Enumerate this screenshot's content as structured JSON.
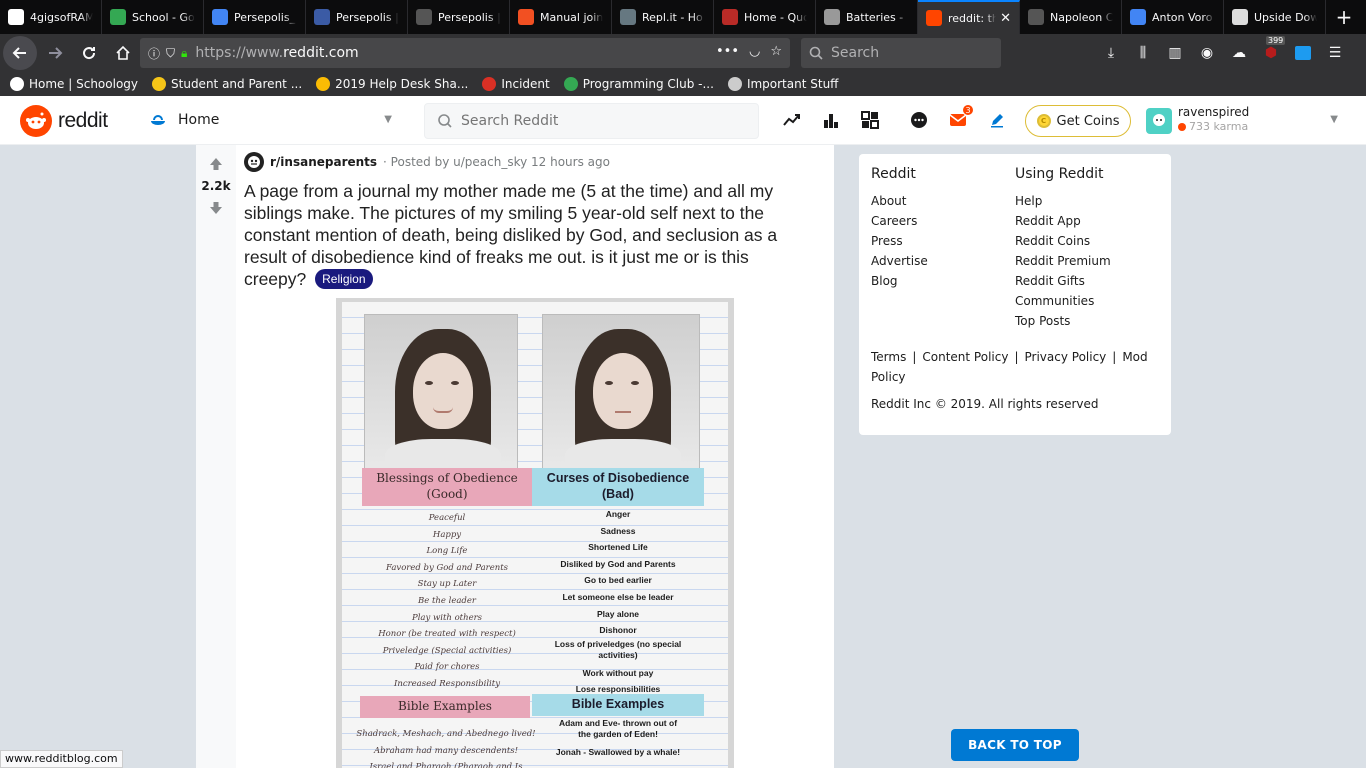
{
  "browser": {
    "tabs": [
      {
        "title": "4gigsofRAM",
        "icon_color": "#ffffff",
        "icon": "firefox-icon"
      },
      {
        "title": "School - Go",
        "icon_color": "#34a853",
        "icon": "google-drive-icon"
      },
      {
        "title": "Persepolis_",
        "icon_color": "#4285f4",
        "icon": "google-docs-icon"
      },
      {
        "title": "Persepolis |",
        "icon_color": "#3b5ba5",
        "icon": "quizlet-icon"
      },
      {
        "title": "Persepolis |",
        "icon_color": "#555555",
        "icon": "schoology-icon"
      },
      {
        "title": "Manual join",
        "icon_color": "#f25022",
        "icon": "microsoft-icon"
      },
      {
        "title": "Repl.it - Ho",
        "icon_color": "#667881",
        "icon": "replit-icon"
      },
      {
        "title": "Home - Quo",
        "icon_color": "#b92b27",
        "icon": "quora-icon"
      },
      {
        "title": "Batteries -",
        "icon_color": "#999999",
        "icon": "apple-icon"
      },
      {
        "title": "reddit: the",
        "icon_color": "#ff4500",
        "icon": "reddit-icon",
        "active": true
      },
      {
        "title": "Napoleon C",
        "icon_color": "#555555",
        "icon": "schoology-icon"
      },
      {
        "title": "Anton Voro",
        "icon_color": "#4285f4",
        "icon": "google-docs-icon"
      },
      {
        "title": "Upside Dow",
        "icon_color": "#dddddd",
        "icon": "page-icon"
      }
    ],
    "url_prefix": "https://www.",
    "url_domain": "reddit.com",
    "search_placeholder": "Search",
    "addon_badge": "399",
    "bookmarks": [
      {
        "label": "Home | Schoology",
        "icon_color": "#ffffff",
        "icon": "schoology-icon"
      },
      {
        "label": "Student and Parent ...",
        "icon_color": "#f5c518",
        "icon": "p-icon"
      },
      {
        "label": "2019 Help Desk Sha...",
        "icon_color": "#fbbc04",
        "icon": "google-drive-icon"
      },
      {
        "label": "Incident",
        "icon_color": "#d93025",
        "icon": "incident-icon"
      },
      {
        "label": "Programming Club -...",
        "icon_color": "#34a853",
        "icon": "google-drive-icon"
      },
      {
        "label": "Important Stuff",
        "icon_color": "#cccccc",
        "icon": "folder-icon"
      }
    ]
  },
  "reddit": {
    "logo_text": "reddit",
    "home_label": "Home",
    "search_placeholder": "Search Reddit",
    "mail_badge": "3",
    "get_coins_label": "Get Coins",
    "username": "ravenspired",
    "karma": "733 karma"
  },
  "post": {
    "votes": "2.2k",
    "subreddit": "r/insaneparents",
    "posted_by": "· Posted by u/peach_sky 12 hours ago",
    "title": "A page from a journal my mother made me (5 at the time) and all my siblings make. The pictures of my smiling 5 year-old self next to the constant mention of death, being disliked by God, and seclusion as a result of disobedience kind of freaks me out. is it just me or is this creepy?",
    "flair": "Religion",
    "journal": {
      "left_heading": "Blessings of Obedience (Good)",
      "right_heading": "Curses of Disobedience (Bad)",
      "left_items": [
        "Peaceful",
        "Happy",
        "Long Life",
        "Favored by God and Parents",
        "Stay up Later",
        "Be the leader",
        "Play with others",
        "Honor (be treated with respect)",
        "Priveledge (Special activities)",
        "Paid for chores",
        "Increased Responsibility"
      ],
      "right_items": [
        "Anger",
        "Sadness",
        "Shortened Life",
        "Disliked by God and Parents",
        "Go to bed earlier",
        "Let someone else be leader",
        "Play alone",
        "Dishonor",
        "Loss of priveledges (no special activities)",
        "Work without pay",
        "Lose responsibilities"
      ],
      "left_heading2": "Bible Examples",
      "right_heading2": "Bible Examples",
      "left_examples": [
        "Shadrack, Meshach, and Abednego lived!",
        "Abraham had many descendents!",
        "Israel and Pharaoh (Pharaoh and Is"
      ],
      "right_examples": [
        "Adam and Eve- thrown out of the garden of Eden!",
        "Jonah - Swallowed by a whale!"
      ]
    }
  },
  "sidebar": {
    "col1_heading": "Reddit",
    "col1_links": [
      "About",
      "Careers",
      "Press",
      "Advertise",
      "Blog"
    ],
    "col2_heading": "Using Reddit",
    "col2_links": [
      "Help",
      "Reddit App",
      "Reddit Coins",
      "Reddit Premium",
      "Reddit Gifts",
      "Communities",
      "Top Posts"
    ],
    "legal_links": [
      "Terms",
      "Content Policy",
      "Privacy Policy",
      "Mod Policy"
    ],
    "copyright": "Reddit Inc © 2019. All rights reserved"
  },
  "back_to_top": "BACK TO TOP",
  "status_url": "www.redditblog.com"
}
